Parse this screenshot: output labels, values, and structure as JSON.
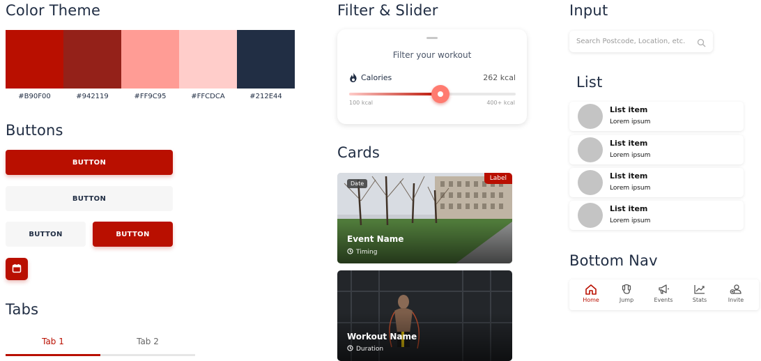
{
  "sections": {
    "color_theme": "Color Theme",
    "buttons": "Buttons",
    "tabs": "Tabs",
    "filter_slider": "Filter & Slider",
    "cards": "Cards",
    "input": "Input",
    "list": "List",
    "bottom_nav": "Bottom Nav"
  },
  "colors": [
    {
      "hex": "#B90F00",
      "label": "#B90F00"
    },
    {
      "hex": "#942119",
      "label": "#942119"
    },
    {
      "hex": "#FF9C95",
      "label": "#FF9C95"
    },
    {
      "hex": "#FFCDCA",
      "label": "#FFCDCA"
    },
    {
      "hex": "#212E44",
      "label": "#212E44"
    }
  ],
  "buttons": {
    "primary_full": "BUTTON",
    "light_full": "BUTTON",
    "light_half": "BUTTON",
    "primary_half": "BUTTON",
    "icon_button": "calendar-icon"
  },
  "tabs": {
    "items": [
      "Tab 1",
      "Tab 2"
    ],
    "active_index": 0
  },
  "filter": {
    "title": "Filter your workout",
    "metric_label": "Calories",
    "metric_value": "262 kcal",
    "min_label": "100 kcal",
    "max_label": "400+ kcal",
    "slider_fraction": 0.55
  },
  "cards": [
    {
      "chip": "Date",
      "badge": "Label",
      "title": "Event Name",
      "subtitle": "Timing"
    },
    {
      "title": "Workout Name",
      "subtitle": "Duration"
    }
  ],
  "search": {
    "placeholder": "Search Postcode, Location, etc."
  },
  "list": [
    {
      "title": "List item",
      "subtitle": "Lorem ipsum"
    },
    {
      "title": "List item",
      "subtitle": "Lorem ipsum"
    },
    {
      "title": "List item",
      "subtitle": "Lorem ipsum"
    },
    {
      "title": "List item",
      "subtitle": "Lorem ipsum"
    }
  ],
  "bottom_nav": {
    "items": [
      {
        "label": "Home",
        "icon": "home-icon",
        "active": true
      },
      {
        "label": "Jump",
        "icon": "jump-rope-icon",
        "active": false
      },
      {
        "label": "Events",
        "icon": "megaphone-icon",
        "active": false
      },
      {
        "label": "Stats",
        "icon": "chart-icon",
        "active": false
      },
      {
        "label": "Invite",
        "icon": "invite-user-icon",
        "active": false
      }
    ]
  }
}
